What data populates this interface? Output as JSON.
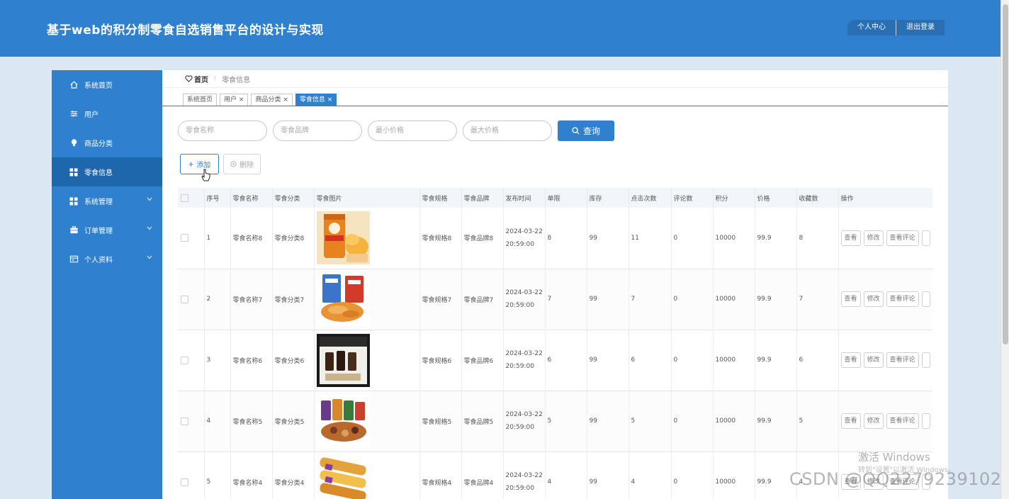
{
  "app": {
    "title": "基于web的积分制零食自选销售平台的设计与实现",
    "personal_center": "个人中心",
    "logout": "退出登录"
  },
  "sidebar": {
    "items": [
      {
        "label": "系统首页",
        "icon": "home-icon",
        "has_caret": false
      },
      {
        "label": "用户",
        "icon": "sliders-icon",
        "has_caret": false
      },
      {
        "label": "商品分类",
        "icon": "bulb-icon",
        "has_caret": false
      },
      {
        "label": "零食信息",
        "icon": "grid-icon",
        "has_caret": false,
        "active": true
      },
      {
        "label": "系统管理",
        "icon": "grid-icon",
        "has_caret": true
      },
      {
        "label": "订单管理",
        "icon": "briefcase-icon",
        "has_caret": true
      },
      {
        "label": "个人资料",
        "icon": "card-icon",
        "has_caret": true
      }
    ]
  },
  "breadcrumb": {
    "home": "首页",
    "current": "零食信息"
  },
  "tabs": [
    {
      "label": "系统首页",
      "closable": false
    },
    {
      "label": "用户",
      "closable": true
    },
    {
      "label": "商品分类",
      "closable": true
    },
    {
      "label": "零食信息",
      "closable": true,
      "active": true
    }
  ],
  "search": {
    "name_placeholder": "零食名称",
    "brand_placeholder": "零食品牌",
    "min_price_placeholder": "最小价格",
    "max_price_placeholder": "最大价格",
    "query_label": "查询"
  },
  "actions": {
    "add_label": "添加",
    "delete_label": "删除"
  },
  "table": {
    "columns": [
      "序号",
      "零食名称",
      "零食分类",
      "零食图片",
      "零食规格",
      "零食品牌",
      "发布时间",
      "单限",
      "库存",
      "点击次数",
      "评论数",
      "积分",
      "价格",
      "收藏数",
      "操作"
    ],
    "row_buttons": [
      "查看",
      "修改",
      "查看评论"
    ],
    "rows": [
      {
        "index": "1",
        "name": "零食名称8",
        "category": "零食分类8",
        "image": "chips-can-image",
        "spec": "零食规格8",
        "brand": "零食品牌8",
        "date": "2024-03-22",
        "time": "20:59:00",
        "limit": "8",
        "stock": "99",
        "clicks": "11",
        "comments": "0",
        "points": "10000",
        "price": "99.9",
        "favorites": "8"
      },
      {
        "index": "2",
        "name": "零食名称7",
        "category": "零食分类7",
        "image": "snack-bags-image",
        "spec": "零食规格7",
        "brand": "零食品牌7",
        "date": "2024-03-22",
        "time": "20:59:00",
        "limit": "7",
        "stock": "99",
        "clicks": "7",
        "comments": "0",
        "points": "10000",
        "price": "99.9",
        "favorites": "7"
      },
      {
        "index": "3",
        "name": "零食名称6",
        "category": "零食分类6",
        "image": "coffee-box-image",
        "spec": "零食规格6",
        "brand": "零食品牌6",
        "date": "2024-03-22",
        "time": "20:59:00",
        "limit": "6",
        "stock": "99",
        "clicks": "6",
        "comments": "0",
        "points": "10000",
        "price": "99.9",
        "favorites": "6"
      },
      {
        "index": "4",
        "name": "零食名称5",
        "category": "零食分类5",
        "image": "nut-packs-image",
        "spec": "零食规格5",
        "brand": "零食品牌5",
        "date": "2024-03-22",
        "time": "20:59:00",
        "limit": "5",
        "stock": "99",
        "clicks": "5",
        "comments": "0",
        "points": "10000",
        "price": "99.9",
        "favorites": "5"
      },
      {
        "index": "5",
        "name": "零食名称4",
        "category": "零食分类4",
        "image": "wafer-rolls-image",
        "spec": "零食规格4",
        "brand": "零食品牌4",
        "date": "2024-03-22",
        "time": "20:59:00",
        "limit": "4",
        "stock": "99",
        "clicks": "4",
        "comments": "0",
        "points": "10000",
        "price": "99.9",
        "favorites": "4"
      }
    ]
  },
  "watermarks": {
    "activate_title": "激活 Windows",
    "activate_sub": "转到\"设置\"以激活 Windows。",
    "csdn": "CSDN @QQ2279239102"
  }
}
